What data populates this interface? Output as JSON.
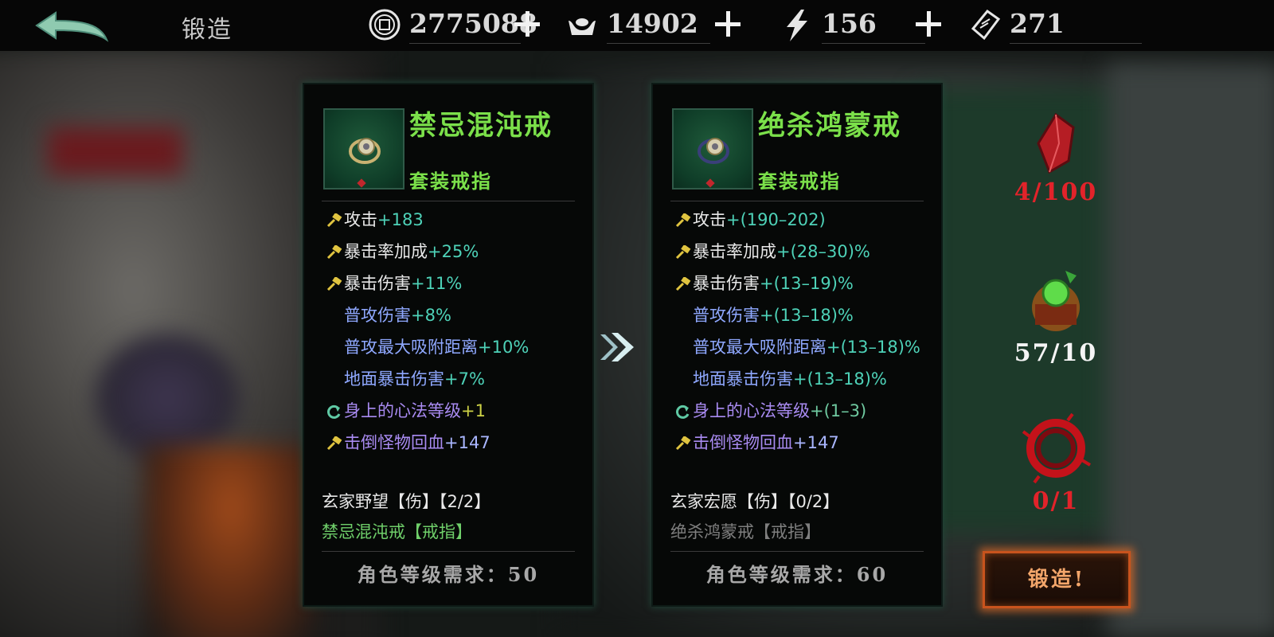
{
  "top_bar": {
    "title": "锻造",
    "resources": [
      {
        "icon": "copper-coin-icon",
        "value": "2775088"
      },
      {
        "icon": "silver-ingot-icon",
        "value": "14902"
      },
      {
        "icon": "lightning-icon",
        "value": "156"
      },
      {
        "icon": "ticket-icon",
        "value": "271"
      }
    ]
  },
  "current_item": {
    "name": "禁忌混沌戒",
    "type": "套装戒指",
    "stats": [
      {
        "icon": "hammer-icon",
        "label": "攻击",
        "value": "+183"
      },
      {
        "icon": "hammer-icon",
        "label": "暴击率加成",
        "value": "+25%"
      },
      {
        "icon": "hammer-icon",
        "label": "暴击伤害",
        "value": "+11%"
      },
      {
        "icon": "",
        "label": "普攻伤害",
        "value": "+8%"
      },
      {
        "icon": "",
        "label": "普攻最大吸附距离",
        "value": "+10%"
      },
      {
        "icon": "",
        "label": "地面暴击伤害",
        "value": "+7%"
      },
      {
        "icon": "refresh-icon",
        "label": "身上的心法等级",
        "value": "+1"
      },
      {
        "icon": "hammer-icon",
        "label": "击倒怪物回血",
        "value": "+147"
      }
    ],
    "set_name": "玄家野望【伤】【2/2】",
    "set_piece": "禁忌混沌戒【戒指】",
    "requirement": "角色等级需求：50"
  },
  "next_item": {
    "name": "绝杀鸿蒙戒",
    "type": "套装戒指",
    "stats": [
      {
        "icon": "hammer-icon",
        "label": "攻击",
        "value": "+(190–202)"
      },
      {
        "icon": "hammer-icon",
        "label": "暴击率加成",
        "value": "+(28–30)%"
      },
      {
        "icon": "hammer-icon",
        "label": "暴击伤害",
        "value": "+(13–19)%"
      },
      {
        "icon": "",
        "label": "普攻伤害",
        "value": "+(13–18)%"
      },
      {
        "icon": "",
        "label": "普攻最大吸附距离",
        "value": "+(13–18)%"
      },
      {
        "icon": "",
        "label": "地面暴击伤害",
        "value": "+(13–18)%"
      },
      {
        "icon": "refresh-icon",
        "label": "身上的心法等级",
        "value": "+(1–3)"
      },
      {
        "icon": "hammer-icon",
        "label": "击倒怪物回血",
        "value": "+147"
      }
    ],
    "set_name": "玄家宏愿【伤】【0/2】",
    "set_piece": "绝杀鸿蒙戒【戒指】",
    "requirement": "角色等级需求：60"
  },
  "materials": [
    {
      "icon": "red-crystal-icon",
      "count": "4/100",
      "color": "#e2232a"
    },
    {
      "icon": "green-orb-icon",
      "count": "57/10",
      "color": "#f5f5f5"
    },
    {
      "icon": "red-thorn-ring-icon",
      "count": "0/1",
      "color": "#e2232a"
    }
  ],
  "forge_button": "锻造!"
}
